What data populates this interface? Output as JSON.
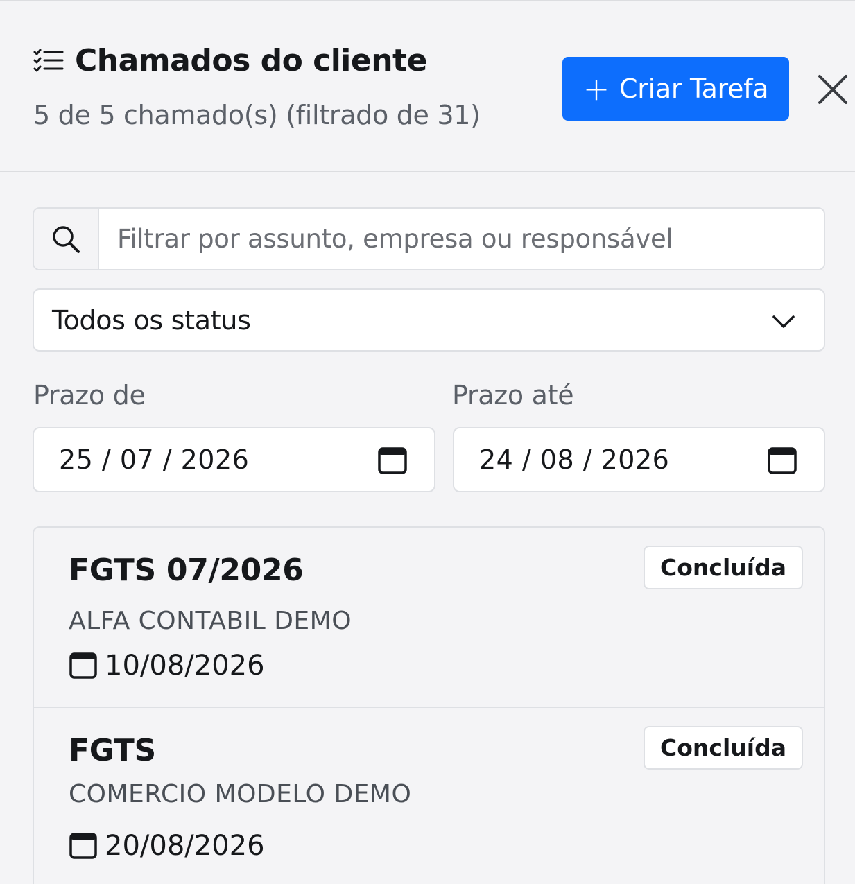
{
  "header": {
    "title": "Chamados do cliente",
    "subtitle": "5 de 5 chamado(s) (filtrado de 31)",
    "title_icon": "list-check-icon",
    "create_button": {
      "icon": "plus",
      "label": "Criar Tarefa"
    },
    "close_icon": "close-icon"
  },
  "filters": {
    "search": {
      "placeholder": "Filtrar por assunto, empresa ou responsável",
      "value": "",
      "icon": "search-icon"
    },
    "status": {
      "selected": "Todos os status"
    },
    "date_from": {
      "label": "Prazo de",
      "value": "25 / 07 / 2026"
    },
    "date_to": {
      "label": "Prazo até",
      "value": "24 / 08 / 2026"
    }
  },
  "tickets": [
    {
      "title": "FGTS 07/2026",
      "company": "ALFA CONTABIL DEMO",
      "due": "10/08/2026",
      "status": "Concluída"
    },
    {
      "title": "FGTS",
      "company": "COMERCIO MODELO DEMO",
      "due": "20/08/2026",
      "status": "Concluída"
    }
  ],
  "colors": {
    "primary": "#0d6efd",
    "background": "#f4f4f6",
    "border": "#dee0e4",
    "muted_text": "#5b6068"
  }
}
